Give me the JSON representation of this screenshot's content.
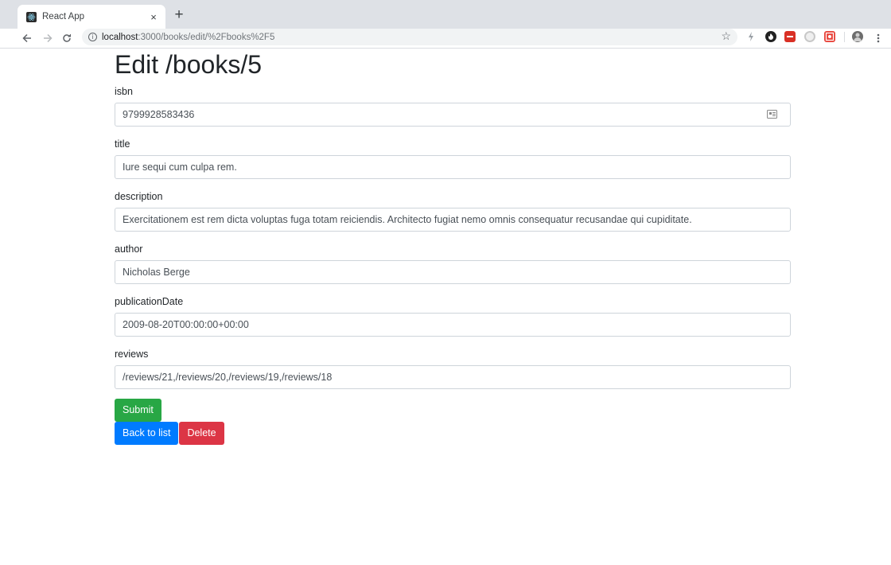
{
  "browser": {
    "tab_title": "React App",
    "tab_close": "×",
    "new_tab": "+",
    "url_host": "localhost",
    "url_path": ":3000/books/edit/%2Fbooks%2F5"
  },
  "page": {
    "heading": "Edit /books/5",
    "fields": [
      {
        "label": "isbn",
        "value": "9799928583436"
      },
      {
        "label": "title",
        "value": "Iure sequi cum culpa rem."
      },
      {
        "label": "description",
        "value": "Exercitationem est rem dicta voluptas fuga totam reiciendis. Architecto fugiat nemo omnis consequatur recusandae qui cupiditate."
      },
      {
        "label": "author",
        "value": "Nicholas Berge"
      },
      {
        "label": "publicationDate",
        "value": "2009-08-20T00:00:00+00:00"
      },
      {
        "label": "reviews",
        "value": "/reviews/21,/reviews/20,/reviews/19,/reviews/18"
      }
    ],
    "submit_label": "Submit",
    "back_label": "Back to list",
    "delete_label": "Delete"
  },
  "colors": {
    "success": "#28a745",
    "primary": "#007bff",
    "danger": "#dc3545"
  },
  "icons": [
    "react-favicon",
    "back-arrow-icon",
    "forward-arrow-icon",
    "reload-icon",
    "info-icon",
    "star-icon",
    "autofill-card-icon"
  ]
}
